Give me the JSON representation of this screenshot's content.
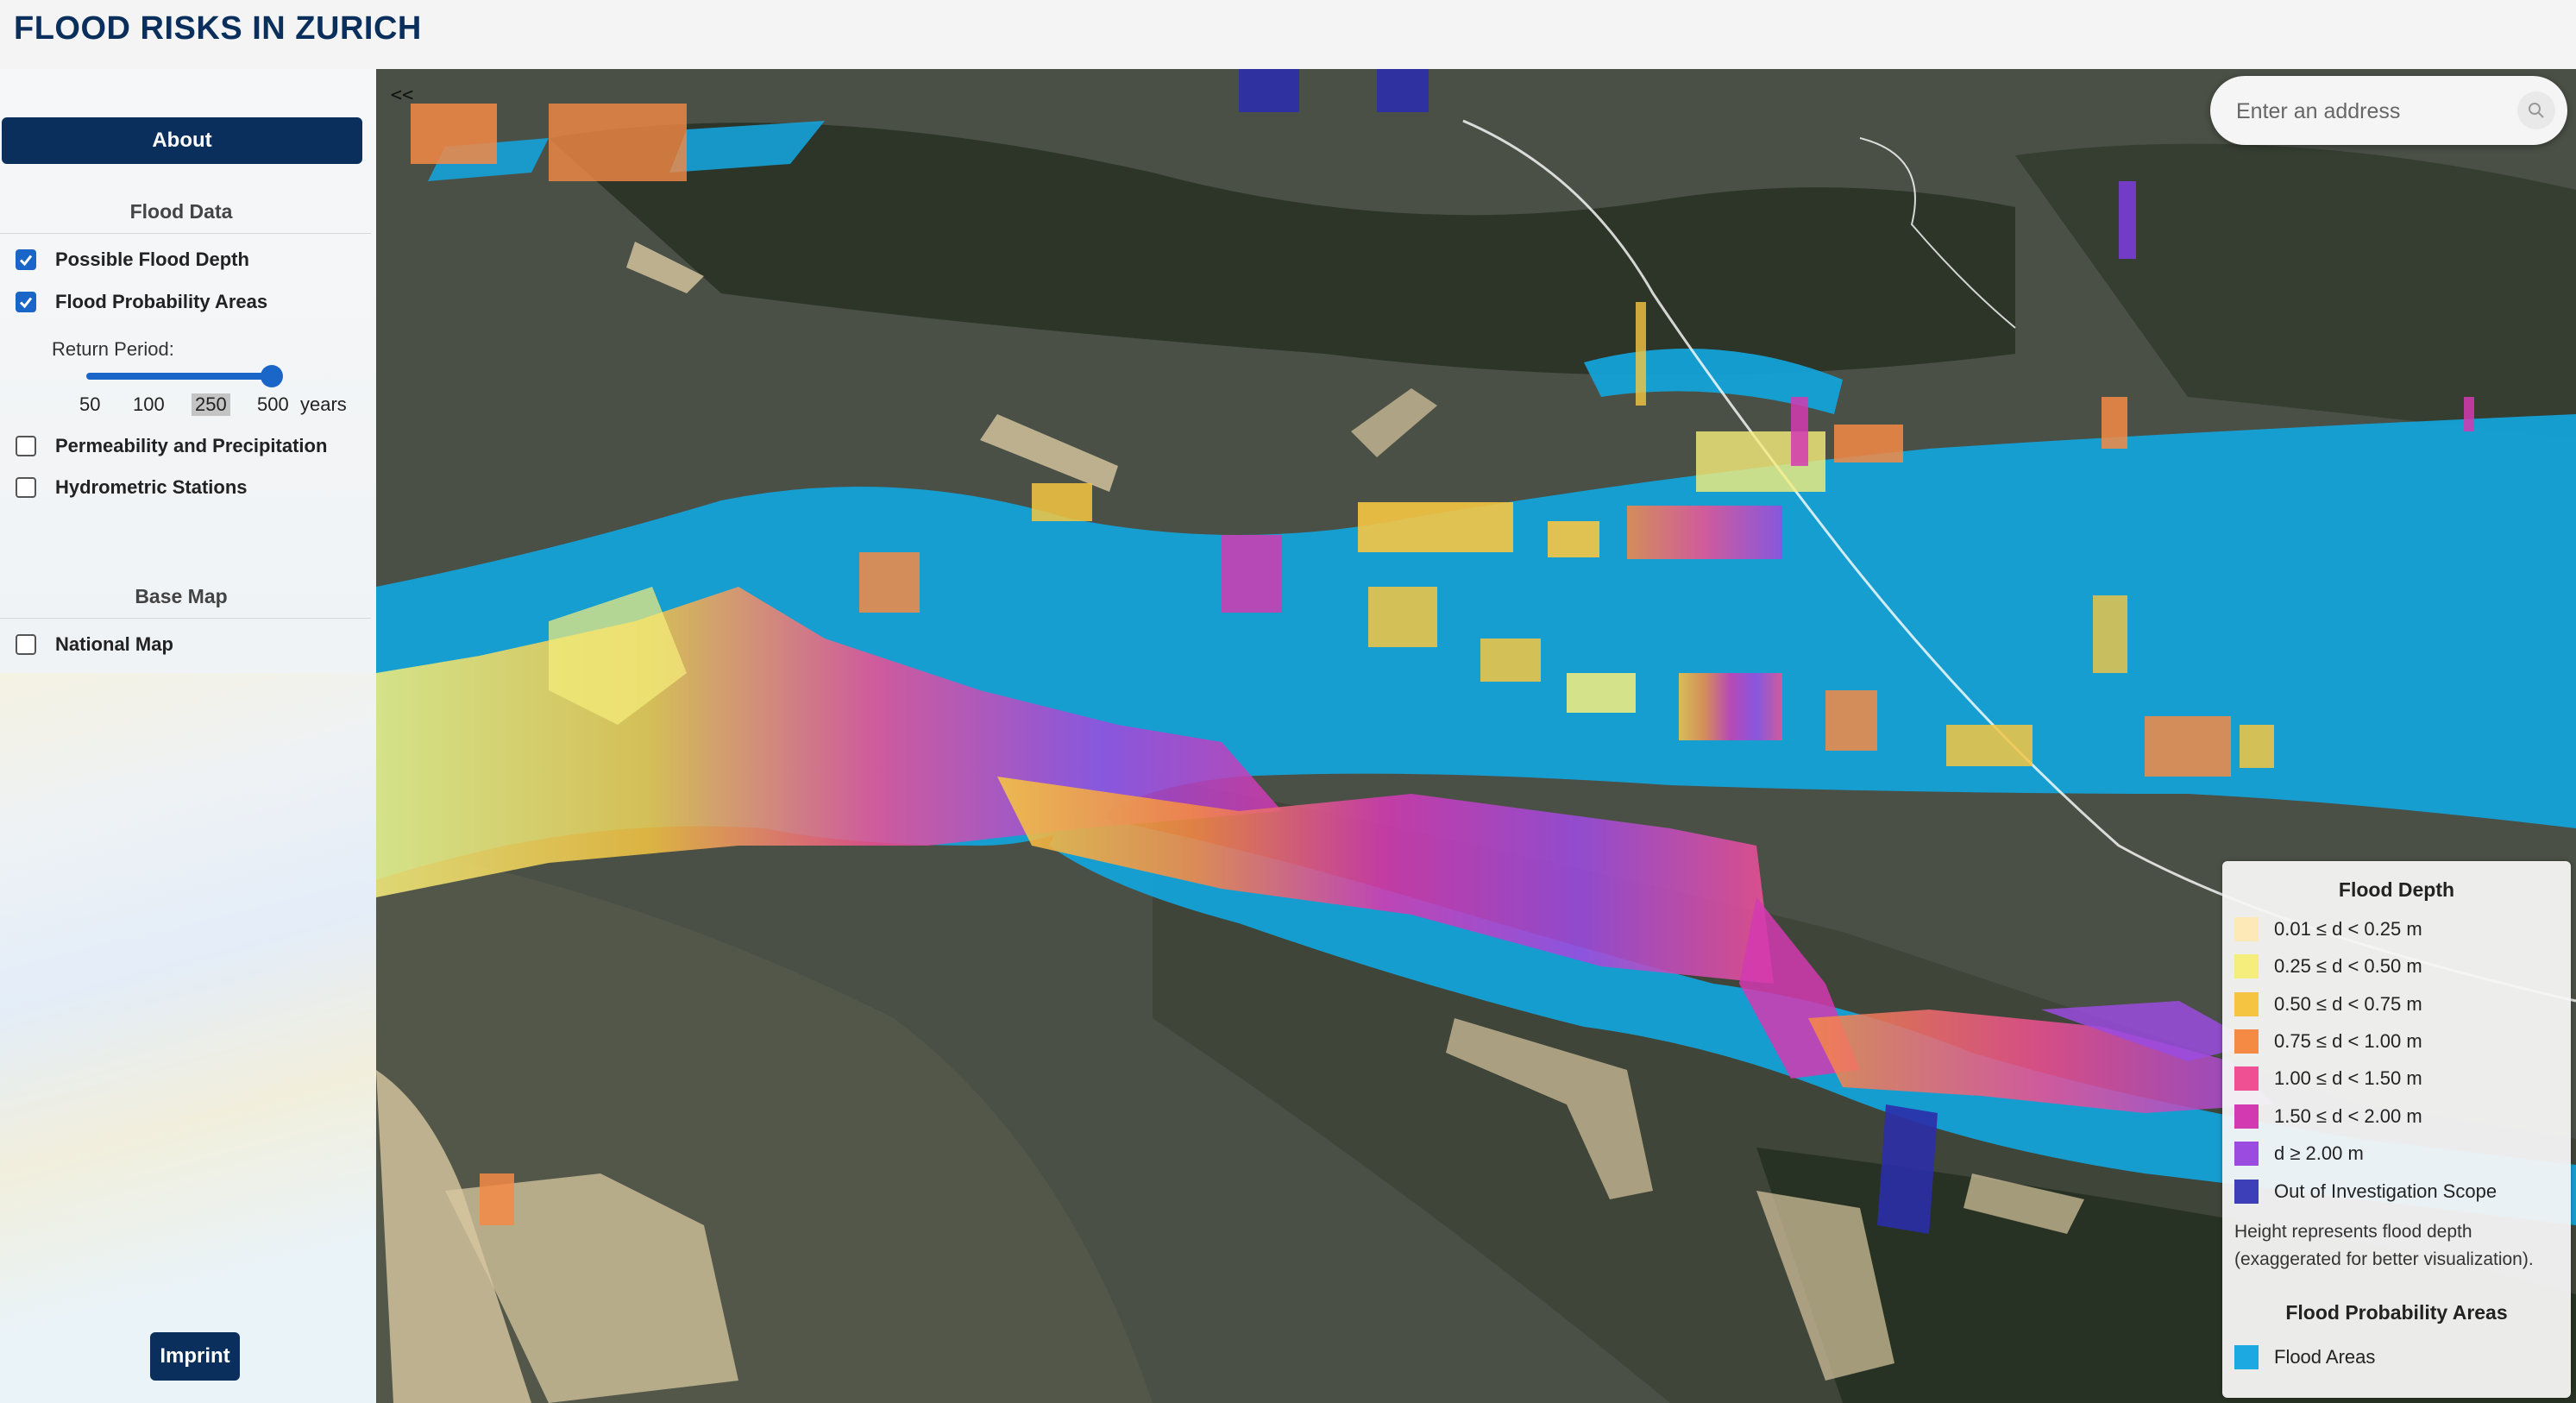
{
  "header": {
    "title": "FLOOD RISKS IN ZURICH"
  },
  "sidebar": {
    "collapse_label": "<<",
    "about_label": "About",
    "flood_data": {
      "title": "Flood Data",
      "layers": [
        {
          "label": "Possible Flood Depth",
          "checked": true
        },
        {
          "label": "Flood Probability Areas",
          "checked": true
        }
      ],
      "return_period": {
        "label": "Return Period:",
        "ticks": [
          "50",
          "100",
          "250",
          "500"
        ],
        "unit": "years",
        "selected": "250"
      },
      "extra_layers": [
        {
          "label": "Permeability and Precipitation",
          "checked": false
        },
        {
          "label": "Hydrometric Stations",
          "checked": false
        }
      ]
    },
    "base_map": {
      "title": "Base Map",
      "layers": [
        {
          "label": "National Map",
          "checked": false
        }
      ]
    },
    "imprint_label": "Imprint"
  },
  "search": {
    "placeholder": "Enter an address",
    "icon": "search-icon"
  },
  "legend": {
    "flood_depth_title": "Flood Depth",
    "depth_classes": [
      {
        "label": "0.01 ≤ d < 0.25 m",
        "color": "#fde9b8"
      },
      {
        "label": "0.25 ≤ d < 0.50 m",
        "color": "#f6ee7c"
      },
      {
        "label": "0.50 ≤ d < 0.75 m",
        "color": "#f5c542"
      },
      {
        "label": "0.75 ≤ d < 1.00 m",
        "color": "#f58a45"
      },
      {
        "label": "1.00 ≤ d < 1.50 m",
        "color": "#ef4f93"
      },
      {
        "label": "1.50 ≤ d < 2.00 m",
        "color": "#d33ab2"
      },
      {
        "label": "d ≥ 2.00 m",
        "color": "#9b4be0"
      },
      {
        "label": "Out of Investigation Scope",
        "color": "#3d3fb8"
      }
    ],
    "note_line1": "Height represents flood depth",
    "note_line2": "(exaggerated for better visualization).",
    "probability_title": "Flood Probability Areas",
    "probability_items": [
      {
        "label": "Flood Areas",
        "color": "#1ca8e0"
      }
    ]
  },
  "colors": {
    "brand": "#0b2f5c",
    "accent": "#1a66c8",
    "water": "#14a2d8"
  }
}
